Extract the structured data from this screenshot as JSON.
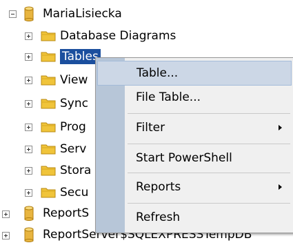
{
  "tree": {
    "root": {
      "label": "MariaLisiecka",
      "expanded": true
    },
    "children": [
      {
        "label": "Database Diagrams"
      },
      {
        "label": "Tables",
        "selected": true
      },
      {
        "label": "View"
      },
      {
        "label": "Sync"
      },
      {
        "label": "Prog"
      },
      {
        "label": "Serv"
      },
      {
        "label": "Stora"
      },
      {
        "label": "Secu"
      }
    ],
    "siblings": [
      {
        "label": "ReportS"
      },
      {
        "label": "ReportServer$SQLEXPRESSTempDB"
      }
    ]
  },
  "context_menu": {
    "items": [
      {
        "label": "Table...",
        "highlighted": true,
        "has_submenu": false
      },
      {
        "label": "File Table...",
        "has_submenu": false
      },
      {
        "label": "Filter",
        "has_submenu": true
      },
      {
        "label": "Start PowerShell",
        "has_submenu": false
      },
      {
        "label": "Reports",
        "has_submenu": true
      },
      {
        "label": "Refresh",
        "has_submenu": false
      }
    ]
  },
  "colors": {
    "selection": "#1b4f9e",
    "menu_highlight": "#ccd7e6",
    "menu_gutter": "#b7c6d8",
    "folder": "#f0c43a",
    "database": "#e8b540"
  }
}
